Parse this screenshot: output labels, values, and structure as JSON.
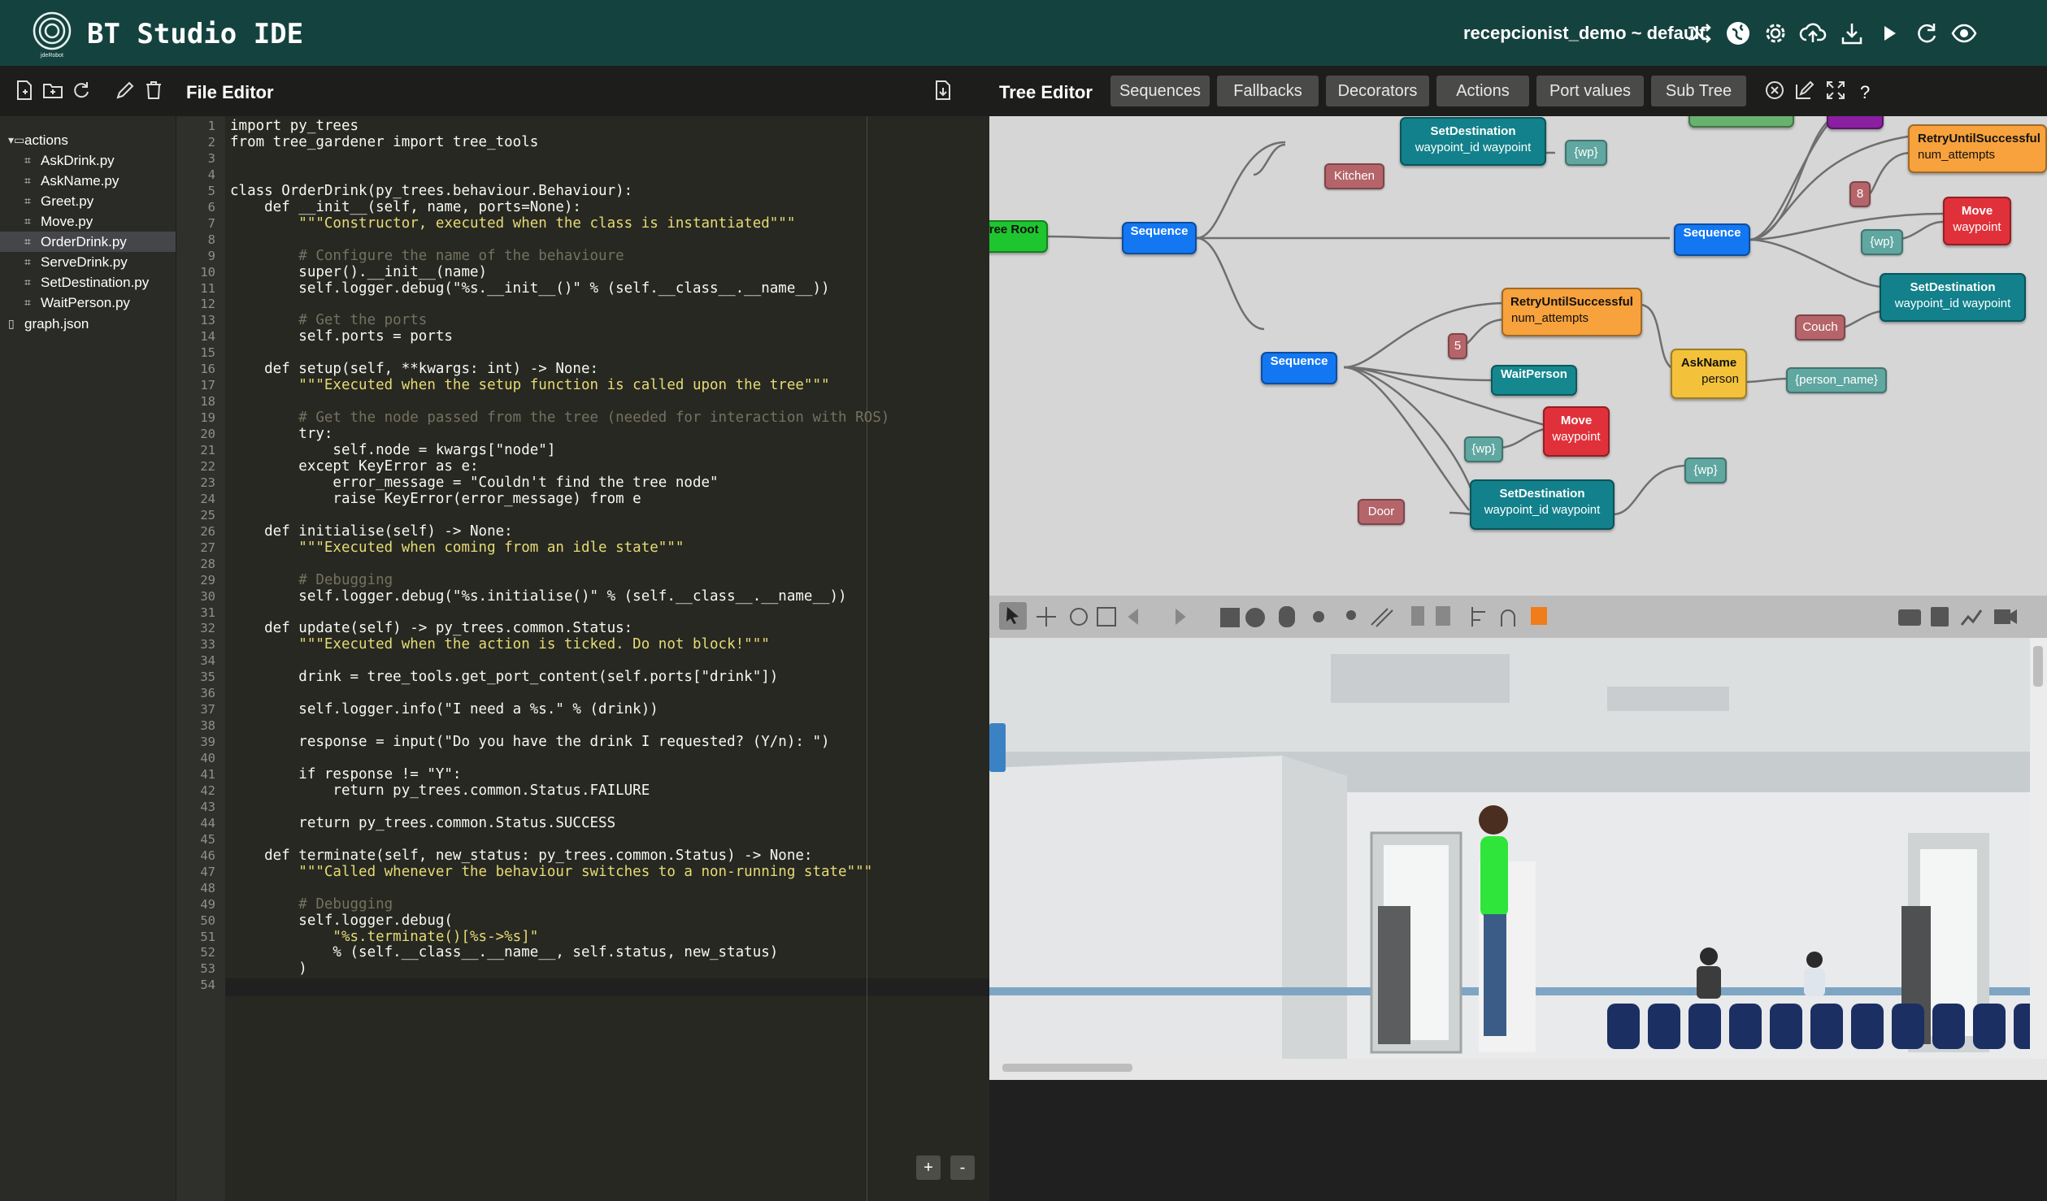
{
  "header": {
    "app_title": "BT Studio IDE",
    "project": "recepcionist_demo ~ default",
    "logo_caption": "jdeRobot"
  },
  "file_editor": {
    "title": "File Editor",
    "tree": [
      {
        "label": "actions",
        "type": "folder"
      },
      {
        "label": "AskDrink.py",
        "type": "file"
      },
      {
        "label": "AskName.py",
        "type": "file"
      },
      {
        "label": "Greet.py",
        "type": "file"
      },
      {
        "label": "Move.py",
        "type": "file"
      },
      {
        "label": "OrderDrink.py",
        "type": "file",
        "selected": true
      },
      {
        "label": "ServeDrink.py",
        "type": "file"
      },
      {
        "label": "SetDestination.py",
        "type": "file"
      },
      {
        "label": "WaitPerson.py",
        "type": "file"
      },
      {
        "label": "graph.json",
        "type": "json"
      }
    ],
    "code_lines": [
      "import py_trees",
      "from tree_gardener import tree_tools",
      "",
      "",
      "class OrderDrink(py_trees.behaviour.Behaviour):",
      "    def __init__(self, name, ports=None):",
      "        \"\"\"Constructor, executed when the class is instantiated\"\"\"",
      "",
      "        # Configure the name of the behavioure",
      "        super().__init__(name)",
      "        self.logger.debug(\"%s.__init__()\" % (self.__class__.__name__))",
      "",
      "        # Get the ports",
      "        self.ports = ports",
      "",
      "    def setup(self, **kwargs: int) -> None:",
      "        \"\"\"Executed when the setup function is called upon the tree\"\"\"",
      "",
      "        # Get the node passed from the tree (needed for interaction with ROS)",
      "        try:",
      "            self.node = kwargs[\"node\"]",
      "        except KeyError as e:",
      "            error_message = \"Couldn't find the tree node\"",
      "            raise KeyError(error_message) from e",
      "",
      "    def initialise(self) -> None:",
      "        \"\"\"Executed when coming from an idle state\"\"\"",
      "",
      "        # Debugging",
      "        self.logger.debug(\"%s.initialise()\" % (self.__class__.__name__))",
      "",
      "    def update(self) -> py_trees.common.Status:",
      "        \"\"\"Executed when the action is ticked. Do not block!\"\"\"",
      "",
      "        drink = tree_tools.get_port_content(self.ports[\"drink\"])",
      "",
      "        self.logger.info(\"I need a %s.\" % (drink))",
      "",
      "        response = input(\"Do you have the drink I requested? (Y/n): \")",
      "",
      "        if response != \"Y\":",
      "            return py_trees.common.Status.FAILURE",
      "",
      "        return py_trees.common.Status.SUCCESS",
      "",
      "    def terminate(self, new_status: py_trees.common.Status) -> None:",
      "        \"\"\"Called whenever the behaviour switches to a non-running state\"\"\"",
      "",
      "        # Debugging",
      "        self.logger.debug(",
      "            \"%s.terminate()[%s->%s]\"",
      "            % (self.__class__.__name__, self.status, new_status)",
      "        )",
      ""
    ],
    "zoom_in": "+",
    "zoom_out": "-"
  },
  "tree_editor": {
    "title": "Tree Editor",
    "buttons": [
      "Sequences",
      "Fallbacks",
      "Decorators",
      "Actions",
      "Port values",
      "Sub Tree"
    ],
    "help": "?",
    "nodes": {
      "tree_root": "Tree Root",
      "seq_left": "Sequence",
      "seq_right": "Sequence",
      "seq_lower": "Sequence",
      "setdest_top": {
        "title": "SetDestination",
        "ports": "waypoint_id  waypoint"
      },
      "setdest_right": {
        "title": "SetDestination",
        "ports": "waypoint_id  waypoint"
      },
      "setdest_bottom": {
        "title": "SetDestination",
        "ports": "waypoint_id  waypoint"
      },
      "retry_top": {
        "title": "RetryUntilSuccessful",
        "ports": "num_attempts"
      },
      "retry_mid": {
        "title": "RetryUntilSuccessful",
        "ports": "num_attempts"
      },
      "move_right": {
        "title": "Move",
        "ports": "waypoint"
      },
      "move_lower": {
        "title": "Move",
        "ports": "waypoint"
      },
      "wait_person": "WaitPerson",
      "ask_name": {
        "title": "AskName",
        "ports": "person"
      }
    },
    "values": {
      "kitchen": "Kitchen",
      "wp_top": "{wp}",
      "eight": "8",
      "wp_right": "{wp}",
      "couch": "Couch",
      "five": "5",
      "person_name": "{person_name}",
      "wp_lower": "{wp}",
      "door": "Door",
      "wp_bottom": "{wp}"
    },
    "colors": {
      "sequence": "#1477f2",
      "action_teal": "#12818b",
      "decorator": "#f7a23c",
      "move": "#e0313a",
      "askname": "#f3c23a",
      "root": "#1fc52f"
    }
  }
}
